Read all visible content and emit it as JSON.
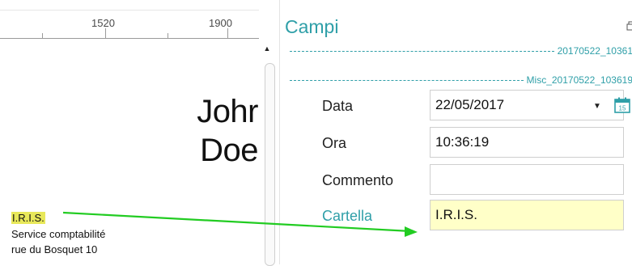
{
  "ruler": {
    "labels": [
      "1520",
      "1900"
    ]
  },
  "document": {
    "name_line1": "Johr",
    "name_line2": "Doe",
    "company": "I.R.I.S.",
    "address_line1": "Service comptabilité",
    "address_line2": "rue du Bosquet 10"
  },
  "panel": {
    "title": "Campi",
    "groups": [
      {
        "label": "20170522_10361"
      },
      {
        "label": "Misc_20170522_103619"
      }
    ],
    "fields": [
      {
        "label": "Data",
        "value": "22/05/2017"
      },
      {
        "label": "Ora",
        "value": "10:36:19"
      },
      {
        "label": "Commento",
        "value": ""
      },
      {
        "label": "Cartella",
        "value": "I.R.I.S."
      }
    ]
  },
  "colors": {
    "accent": "#2f9fa8",
    "highlight_field": "#ffffc8",
    "highlight_text": "#e8e85a",
    "arrow": "#22cc22"
  },
  "icons": [
    "restore-window-icon",
    "calendar-icon",
    "chevron-down-icon",
    "scroll-up-icon"
  ]
}
